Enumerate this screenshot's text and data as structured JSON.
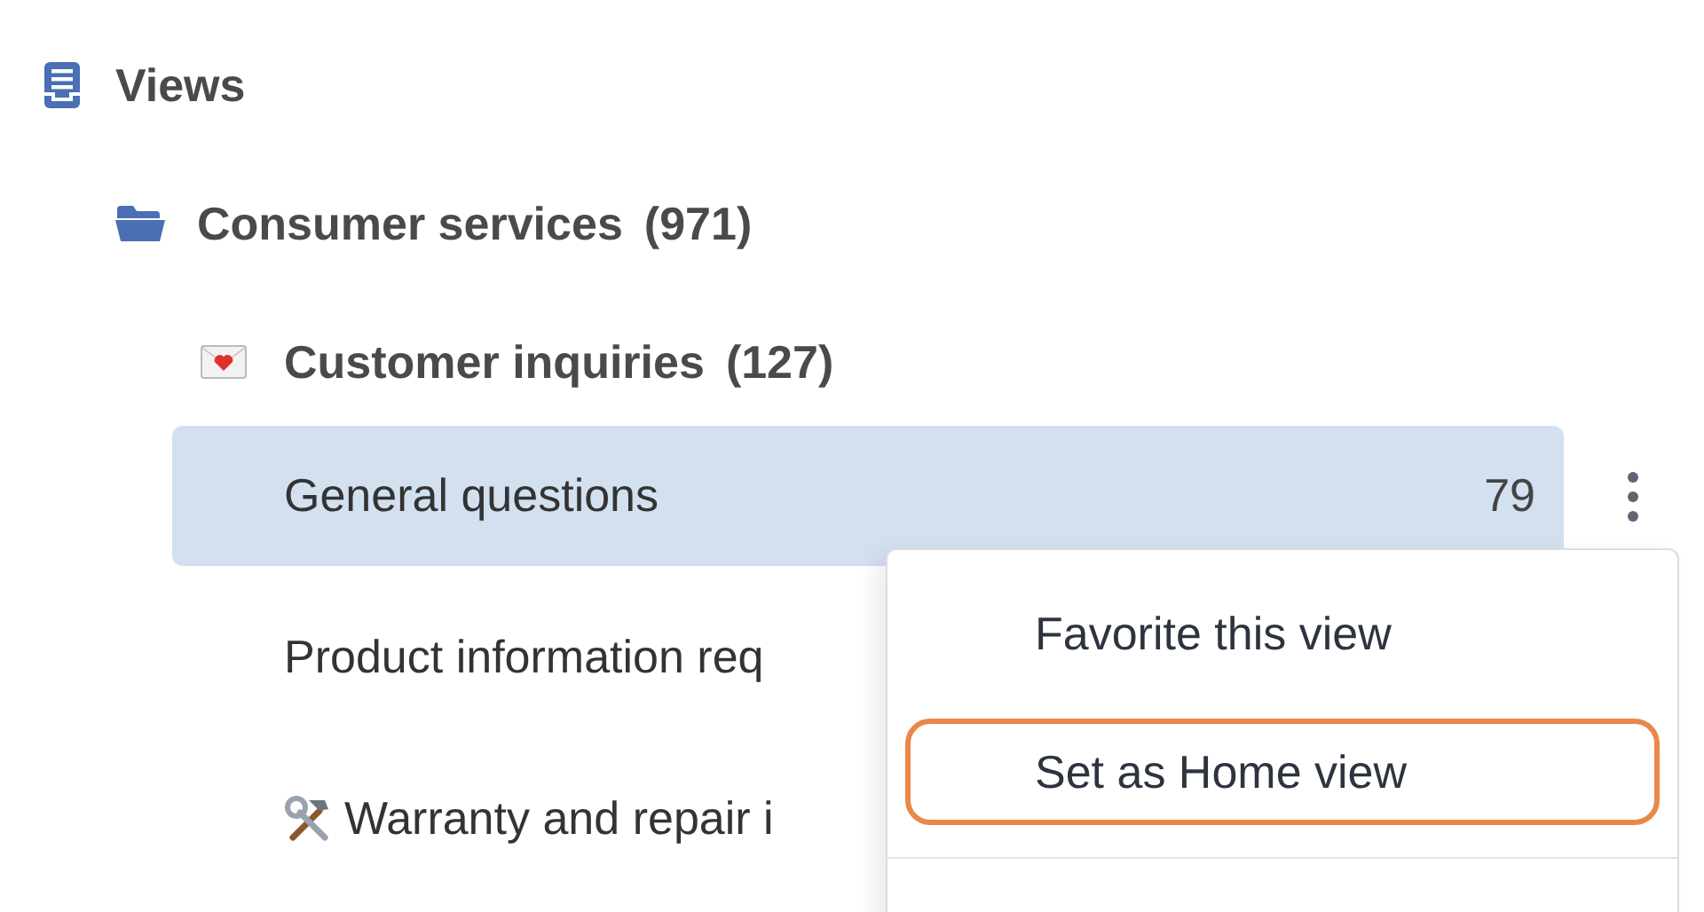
{
  "views": {
    "title": "Views"
  },
  "folder": {
    "name": "Consumer services",
    "count": "(971)",
    "expanded": true
  },
  "subfolder": {
    "name": "Customer inquiries",
    "count": "(127)"
  },
  "items": [
    {
      "kind": "plain",
      "label": "General questions",
      "count": "79",
      "selected": true
    },
    {
      "kind": "plain",
      "label": "Product information req",
      "selected": false
    },
    {
      "kind": "tools",
      "label": "Warranty and repair i",
      "selected": false
    }
  ],
  "menu": {
    "items": [
      {
        "label": "Favorite this view",
        "selected": false
      },
      {
        "label": "Set as Home view",
        "selected": true
      }
    ]
  }
}
